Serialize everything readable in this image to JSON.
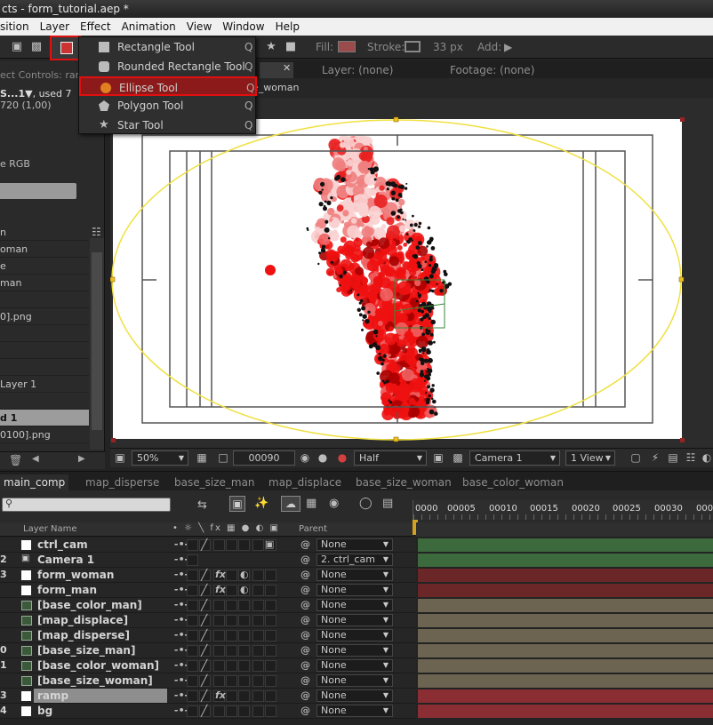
{
  "window": {
    "title": "cts - form_tutorial.aep *"
  },
  "menubar": [
    "sition",
    "Layer",
    "Effect",
    "Animation",
    "View",
    "Window",
    "Help"
  ],
  "toolbar": {
    "fill_label": "Fill:",
    "stroke_label": "Stroke:",
    "stroke_width": "33 px",
    "add_label": "Add:"
  },
  "shape_menu": {
    "items": [
      {
        "label": "Rectangle Tool",
        "shortcut": "Q",
        "icon": "rectangle-icon"
      },
      {
        "label": "Rounded Rectangle Tool",
        "shortcut": "Q",
        "icon": "rounded-rectangle-icon"
      },
      {
        "label": "Ellipse Tool",
        "shortcut": "Q",
        "icon": "ellipse-icon",
        "selected": true
      },
      {
        "label": "Polygon Tool",
        "shortcut": "Q",
        "icon": "polygon-icon"
      },
      {
        "label": "Star Tool",
        "shortcut": "Q",
        "icon": "star-icon"
      }
    ]
  },
  "project": {
    "effect_controls": "ect Controls: ran",
    "comp_name": "S...1",
    "used": ", used 7",
    "resolution": "720 (1,00)",
    "color": "e RGB",
    "items": [
      "n",
      "oman",
      "e",
      "man",
      "",
      "0].png",
      "",
      "",
      "",
      "Layer 1",
      "",
      "d 1",
      "0100].png"
    ],
    "highlighted_index": 11
  },
  "comp": {
    "tabs": [
      "Layer: (none)",
      "Footage: (none)"
    ],
    "breadcrumb": "e_woman",
    "footer": {
      "zoom": "50%",
      "timecode": "00090",
      "resolution": "Half",
      "camera": "Camera 1",
      "views": "1 View"
    }
  },
  "timeline": {
    "tabs": [
      "main_comp",
      "map_disperse",
      "base_size_man",
      "map_displace",
      "base_size_woman",
      "base_color_woman"
    ],
    "active_tab": 0,
    "header": {
      "layer_name": "Layer Name",
      "parent": "Parent"
    },
    "ruler": [
      "0000",
      "00005",
      "00010",
      "00015",
      "00020",
      "00025",
      "00030",
      "000"
    ],
    "layers": [
      {
        "num": "",
        "name": "ctrl_cam",
        "type": "solid",
        "parent": "None",
        "fx": false,
        "track": "#3d6a3d"
      },
      {
        "num": "2",
        "name": "Camera 1",
        "type": "camera",
        "parent": "2. ctrl_cam",
        "fx": false,
        "track": "#3d6a3d"
      },
      {
        "num": "3",
        "name": "form_woman",
        "type": "solid",
        "parent": "None",
        "fx": true,
        "track": "#6b2727"
      },
      {
        "num": "",
        "name": "form_man",
        "type": "solid",
        "parent": "None",
        "fx": true,
        "track": "#6b2727"
      },
      {
        "num": "",
        "name": "[base_color_man]",
        "type": "comp",
        "parent": "None",
        "fx": false,
        "track": "#6c6450"
      },
      {
        "num": "",
        "name": "[map_displace]",
        "type": "comp",
        "parent": "None",
        "fx": false,
        "track": "#6c6450"
      },
      {
        "num": "",
        "name": "[map_disperse]",
        "type": "comp",
        "parent": "None",
        "fx": false,
        "track": "#6c6450"
      },
      {
        "num": "0",
        "name": "[base_size_man]",
        "type": "comp",
        "parent": "None",
        "fx": false,
        "track": "#6c6450"
      },
      {
        "num": "1",
        "name": "[base_color_woman]",
        "type": "comp",
        "parent": "None",
        "fx": false,
        "track": "#6c6450"
      },
      {
        "num": "",
        "name": "[base_size_woman]",
        "type": "comp",
        "parent": "None",
        "fx": false,
        "track": "#6c6450"
      },
      {
        "num": "3",
        "name": "ramp",
        "type": "solid",
        "parent": "None",
        "fx": true,
        "track": "#8a2e34",
        "highlight": true
      },
      {
        "num": "4",
        "name": "bg",
        "type": "solid",
        "parent": "None",
        "fx": false,
        "track": "#8a2e34"
      }
    ]
  },
  "colors": {
    "accent_red": "#e01010",
    "selection_yellow": "#f0e040",
    "particle_red": "#ee1111"
  }
}
